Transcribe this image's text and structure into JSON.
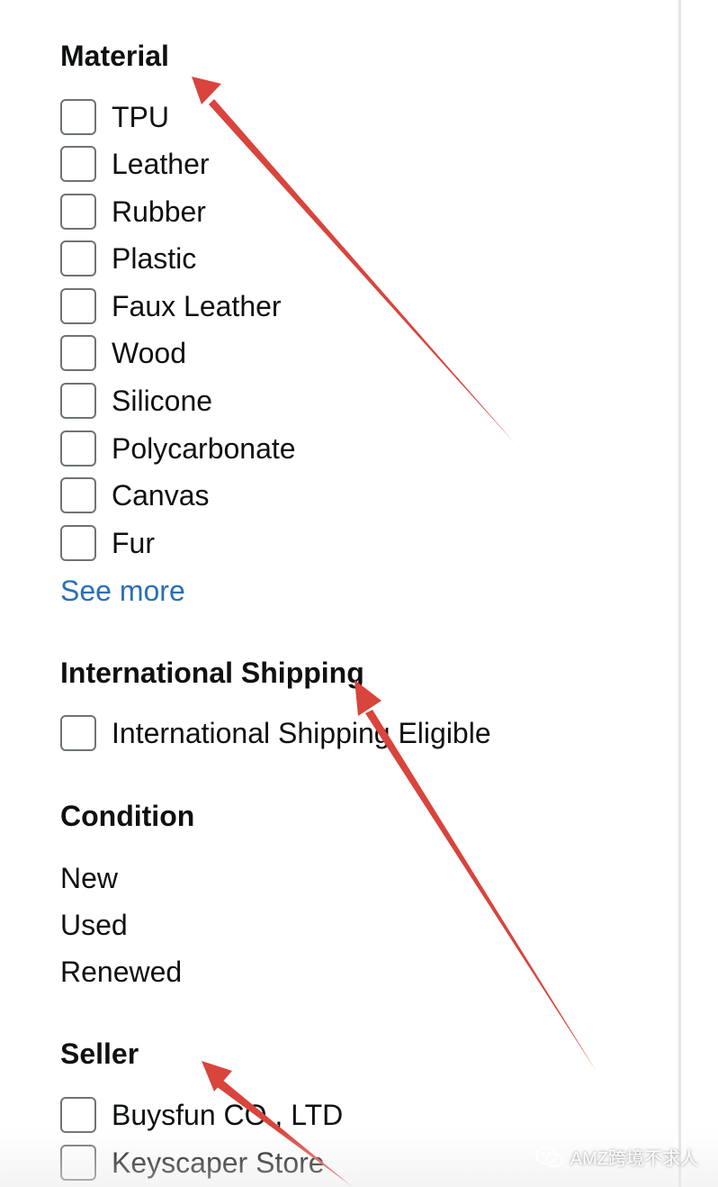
{
  "material": {
    "heading": "Material",
    "options": [
      "TPU",
      "Leather",
      "Rubber",
      "Plastic",
      "Faux Leather",
      "Wood",
      "Silicone",
      "Polycarbonate",
      "Canvas",
      "Fur"
    ],
    "see_more": "See more"
  },
  "international_shipping": {
    "heading": "International Shipping",
    "option": "International Shipping Eligible"
  },
  "condition": {
    "heading": "Condition",
    "options": [
      "New",
      "Used",
      "Renewed"
    ]
  },
  "seller": {
    "heading": "Seller",
    "options": [
      "Buysfun CO., LTD",
      "Keyscaper Store"
    ]
  },
  "watermark": {
    "text": "AMZ跨境不求人",
    "icon": "wechat-icon"
  },
  "colors": {
    "link": "#2a6fb8",
    "annotation_arrow": "#d9443c",
    "checkbox_border": "#6f7373",
    "text": "#0f1111"
  }
}
